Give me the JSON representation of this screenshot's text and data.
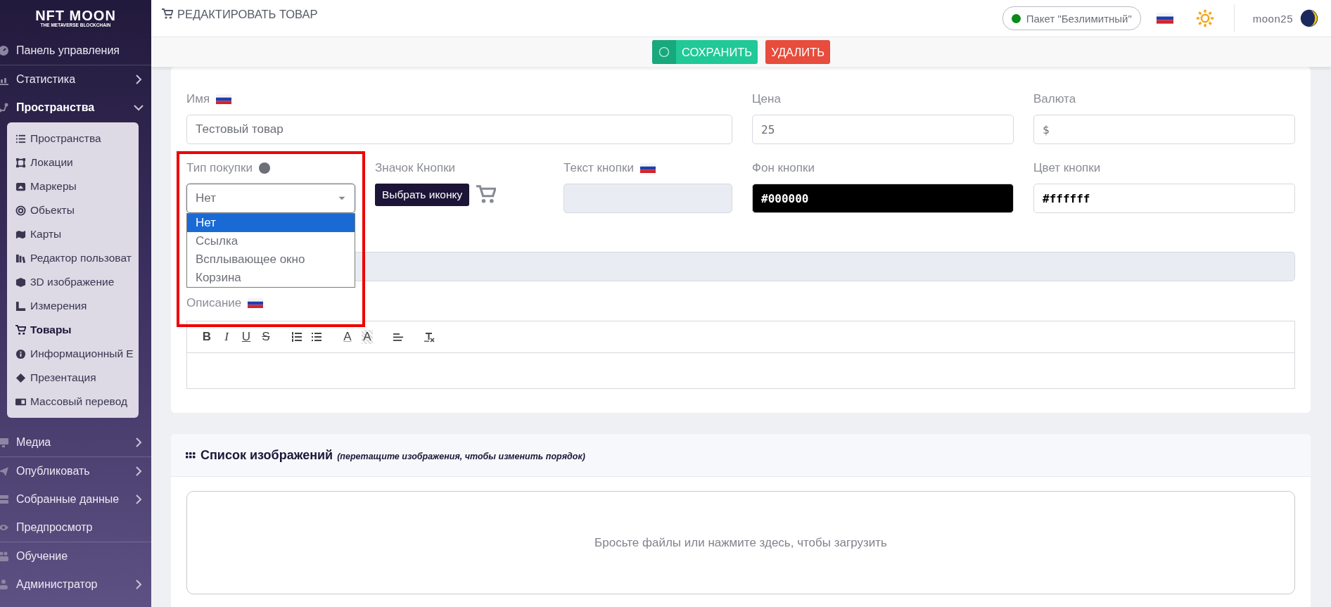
{
  "sidebar": {
    "logo": {
      "title": "NFT MOON",
      "subtitle": "THE METAVERSE BLOCKCHAIN"
    },
    "items": [
      {
        "label": "Панель управления"
      },
      {
        "label": "Статистика",
        "expanded": false
      },
      {
        "label": "Пространства",
        "expanded": true,
        "children": [
          {
            "label": "Пространства",
            "selected": false
          },
          {
            "label": "Локации",
            "selected": false
          },
          {
            "label": "Маркеры",
            "selected": false
          },
          {
            "label": "Обьекты",
            "selected": false
          },
          {
            "label": "Карты",
            "selected": false
          },
          {
            "label": "Редактор пользоват",
            "selected": false
          },
          {
            "label": "3D изображение",
            "selected": false
          },
          {
            "label": "Измерения",
            "selected": false
          },
          {
            "label": "Товары",
            "selected": true
          },
          {
            "label": "Информационный Е",
            "selected": false
          },
          {
            "label": "Презентация",
            "selected": false
          },
          {
            "label": "Массовый перевод",
            "selected": false
          }
        ]
      },
      {
        "label": "Медиа",
        "expanded": false
      },
      {
        "label": "Опубликовать",
        "expanded": false
      },
      {
        "label": "Собранные данные",
        "expanded": false
      },
      {
        "label": "Предпросмотр"
      },
      {
        "label": "Обучение"
      },
      {
        "label": "Администратор",
        "expanded": false
      }
    ]
  },
  "topbar": {
    "title": "РЕДАКТИРОВАТЬ ТОВАР",
    "plan": "Пакет \"Безлимитный\"",
    "user": "moon25"
  },
  "actions": [
    {
      "kind": "save",
      "label": "СОХРАНИТЬ"
    },
    {
      "kind": "delete",
      "label": "УДАЛИТЬ"
    }
  ],
  "form": {
    "name": {
      "label": "Имя",
      "flag": true,
      "value": "Тестовый товар"
    },
    "price": {
      "label": "Цена",
      "flag": false,
      "value": "25"
    },
    "currency": {
      "label": "Валюта",
      "flag": false,
      "value": "$"
    },
    "purchase_type": {
      "label": "Тип покупки",
      "help": true,
      "value": "Нет",
      "open": true,
      "options": [
        {
          "label": "Нет",
          "selected": true
        },
        {
          "label": "Ссылка",
          "selected": false
        },
        {
          "label": "Всплывающее окно",
          "selected": false
        },
        {
          "label": "Корзина",
          "selected": false
        }
      ]
    },
    "button_icon": {
      "label": "Значок Кнопки",
      "button": "Выбрать иконку"
    },
    "button_text": {
      "label": "Текст кнопки",
      "flag": true,
      "disabled": true
    },
    "button_background": {
      "label": "Фон кнопки",
      "value": "#000000"
    },
    "button_color": {
      "label": "Цвет кнопки",
      "value": "#ffffff"
    },
    "extra_field": {
      "disabled": true
    },
    "description": {
      "label": "Описание",
      "flag": true,
      "toolbar": [
        {
          "kind": "bold",
          "glyph": "B"
        },
        {
          "kind": "italic",
          "glyph": "I"
        },
        {
          "kind": "underline",
          "glyph": "U"
        },
        {
          "kind": "strike",
          "glyph": "S"
        },
        {
          "kind": "ordered-list"
        },
        {
          "kind": "bullet-list"
        },
        {
          "kind": "font-color",
          "glyph": "A"
        },
        {
          "kind": "highlight",
          "glyph": "A"
        },
        {
          "kind": "align-left"
        },
        {
          "kind": "clear-format"
        }
      ]
    }
  },
  "annotation": {
    "kind": "highlight-box"
  },
  "images": {
    "title": "Список изображений",
    "hint": "(перетащите изображения, чтобы изменить порядок)",
    "dropzone": "Бросьте файлы или нажмите здесь, чтобы загрузить"
  }
}
